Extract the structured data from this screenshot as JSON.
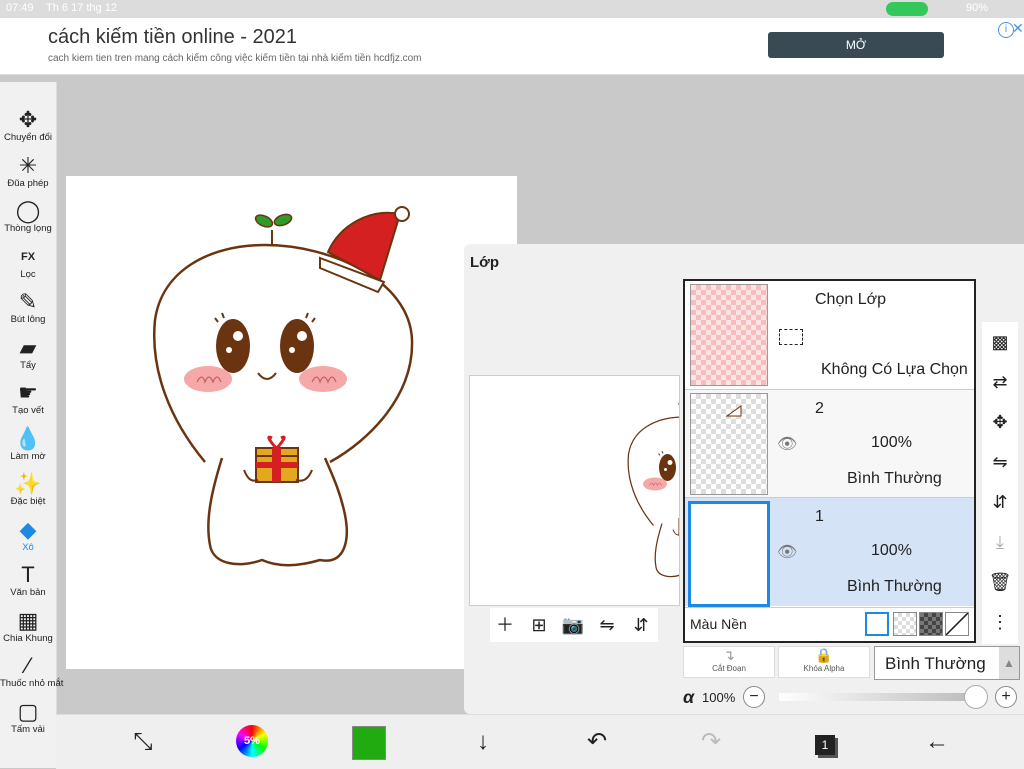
{
  "status": {
    "time": "07:49",
    "date": "Th 6 17 thg 12",
    "battery": "90%"
  },
  "ad": {
    "title": "cách kiếm tiền online - 2021",
    "subtitle": "cach kiem tien tren mang cách kiếm công việc kiếm tiền tại nhà kiếm tiền hcdfjz.com",
    "button": "MỞ"
  },
  "tools": [
    {
      "label": "Chuyển đổi",
      "icon": "move-icon",
      "glyph": "✥"
    },
    {
      "label": "Đũa phép",
      "icon": "magic-wand-icon",
      "glyph": "✳"
    },
    {
      "label": "Thòng lọng",
      "icon": "lasso-icon",
      "glyph": "◯"
    },
    {
      "label": "Lọc",
      "icon": "fx-filter-icon",
      "glyph": "FX"
    },
    {
      "label": "Bút lông",
      "icon": "brush-icon",
      "glyph": "✎"
    },
    {
      "label": "Tẩy",
      "icon": "eraser-icon",
      "glyph": "▰"
    },
    {
      "label": "Tạo vết",
      "icon": "smudge-icon",
      "glyph": "☛"
    },
    {
      "label": "Làm mờ",
      "icon": "blur-drop-icon",
      "glyph": "💧"
    },
    {
      "label": "Đặc biệt",
      "icon": "special-brush-icon",
      "glyph": "✨"
    },
    {
      "label": "Xô",
      "icon": "bucket-fill-icon",
      "glyph": "◆"
    },
    {
      "label": "Văn bản",
      "icon": "text-icon",
      "glyph": "T"
    },
    {
      "label": "Chia Khung",
      "icon": "frame-divider-icon",
      "glyph": "▦"
    },
    {
      "label": "Thuốc nhỏ mắt",
      "icon": "eyedropper-icon",
      "glyph": "⁄"
    },
    {
      "label": "Tấm vải",
      "icon": "canvas-icon",
      "glyph": "▢"
    }
  ],
  "active_tool": "Xô",
  "layers_panel": {
    "title": "Lớp",
    "selection_layer": {
      "title": "Chọn Lớp",
      "status": "Không Có Lựa Chọn"
    },
    "layers": [
      {
        "name": "2",
        "opacity": "100%",
        "blend": "Bình Thường"
      },
      {
        "name": "1",
        "opacity": "100%",
        "blend": "Bình Thường",
        "selected": true
      }
    ],
    "background_label": "Màu Nền",
    "clip_label": "Cắt Đoạn",
    "alpha_lock_label": "Khóa Alpha",
    "blend_mode": "Bình Thường",
    "alpha_symbol": "α",
    "alpha_value": "100%",
    "alpha_level": 1.0
  },
  "bottombar": {
    "color_wheel_label": "5%",
    "current_color": "#22aa11",
    "layer_count": "1"
  },
  "colors": {
    "accent": "#1e88e5",
    "selected_row": "#d5e3f7",
    "ad_button": "#3a4a55",
    "drawing_line": "#6b3410"
  }
}
